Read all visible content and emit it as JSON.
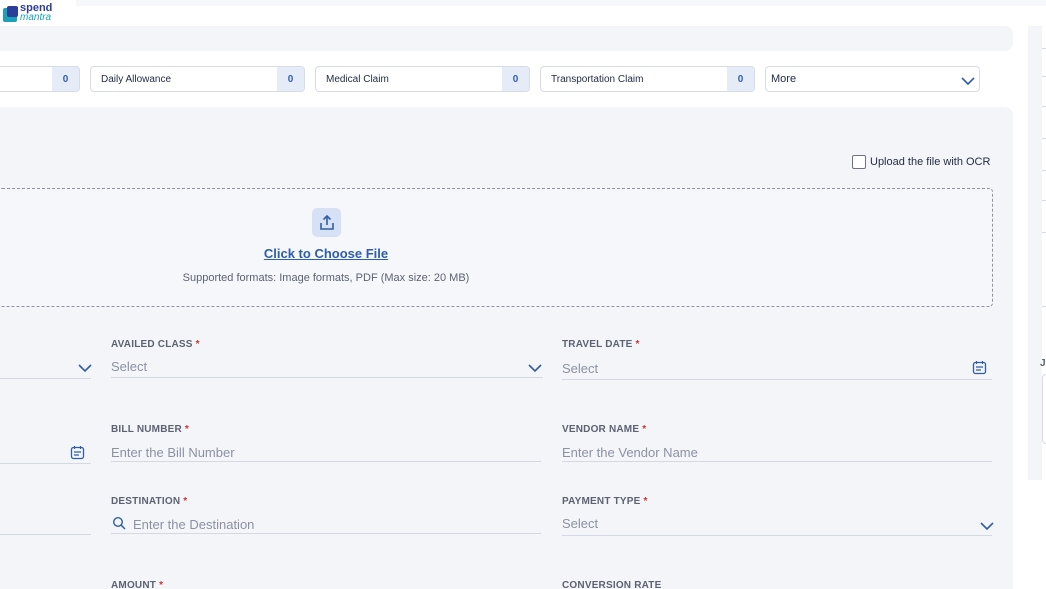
{
  "logo": {
    "line1": "spend",
    "line2": "mantra"
  },
  "categories": [
    {
      "label": "",
      "count": "0"
    },
    {
      "label": "Daily Allowance",
      "count": "0"
    },
    {
      "label": "Medical Claim",
      "count": "0"
    },
    {
      "label": "Transportation Claim",
      "count": "0"
    }
  ],
  "more": {
    "label": "More"
  },
  "ocr": {
    "label": "Upload the file with OCR"
  },
  "upload": {
    "choose_label": "Click to Choose File",
    "formats_text": "Supported formats: Image formats, PDF (Max size: 20 MB)"
  },
  "fields": {
    "availed_class": {
      "label": "AVAILED CLASS",
      "value": "Select"
    },
    "travel_date": {
      "label": "TRAVEL DATE",
      "value": "Select"
    },
    "bill_number": {
      "label": "BILL NUMBER",
      "placeholder": "Enter the Bill Number"
    },
    "vendor_name": {
      "label": "VENDOR NAME",
      "placeholder": "Enter the Vendor Name"
    },
    "destination": {
      "label": "DESTINATION",
      "placeholder": "Enter the Destination"
    },
    "payment_type": {
      "label": "PAYMENT TYPE",
      "value": "Select"
    },
    "amount": {
      "label": "AMOUNT"
    },
    "conversion_rate": {
      "label": "CONVERSION RATE"
    }
  },
  "required_marker": "*",
  "right_panel": {
    "label_fragment": "J"
  },
  "colors": {
    "accent": "#2f5ea8",
    "panel": "#f4f5f9",
    "required": "#d33232"
  }
}
